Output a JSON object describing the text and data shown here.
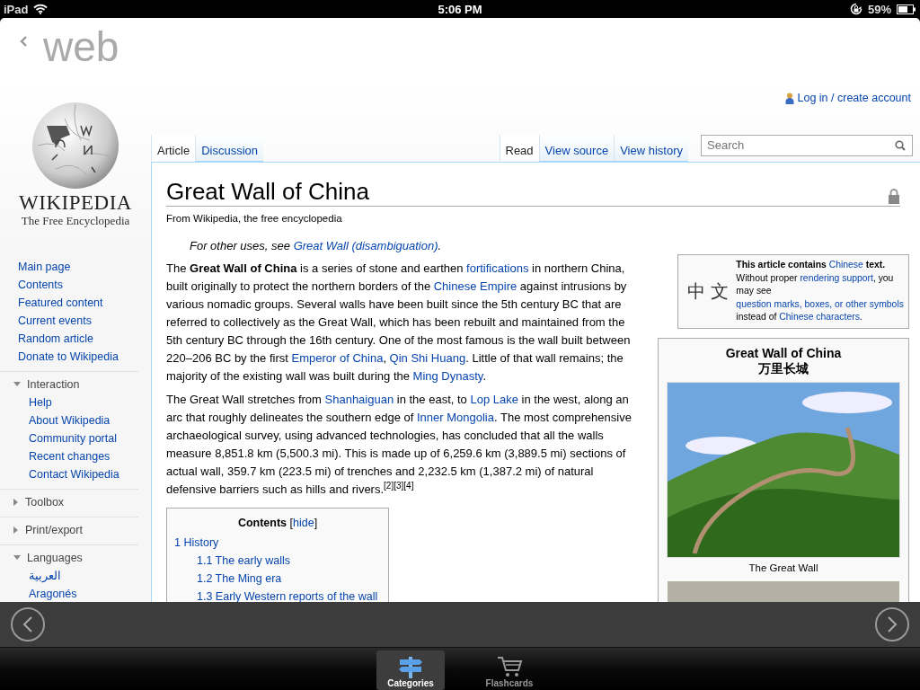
{
  "status_bar": {
    "carrier": "iPad",
    "time": "5:06 PM",
    "battery": "59%"
  },
  "app_header": {
    "title": "web"
  },
  "wiki": {
    "personal_link": "Log in / create account",
    "logo": {
      "wordmark": "WIKIPEDIA",
      "tagline": "The Free Encyclopedia"
    },
    "nav": [
      "Main page",
      "Contents",
      "Featured content",
      "Current events",
      "Random article",
      "Donate to Wikipedia"
    ],
    "portals": [
      {
        "title": "Interaction",
        "expanded": true,
        "items": [
          "Help",
          "About Wikipedia",
          "Community portal",
          "Recent changes",
          "Contact Wikipedia"
        ]
      },
      {
        "title": "Toolbox",
        "expanded": false
      },
      {
        "title": "Print/export",
        "expanded": false
      },
      {
        "title": "Languages",
        "expanded": true,
        "items": [
          "العربية",
          "Aragonés"
        ]
      }
    ],
    "left_tabs": [
      {
        "label": "Article",
        "selected": true
      },
      {
        "label": "Discussion",
        "selected": false
      }
    ],
    "right_tabs": [
      {
        "label": "Read",
        "selected": true
      },
      {
        "label": "View source",
        "selected": false
      },
      {
        "label": "View history",
        "selected": false
      }
    ],
    "search": {
      "placeholder": "Search"
    },
    "title": "Great Wall of China",
    "tagline": "From Wikipedia, the free encyclopedia",
    "hatnote": [
      {
        "kind": "plain",
        "text": "For other uses, see "
      },
      {
        "kind": "link",
        "text": "Great Wall (disambiguation)"
      },
      {
        "kind": "plain",
        "text": "."
      }
    ],
    "paragraphs": [
      [
        {
          "kind": "plain",
          "text": "The "
        },
        {
          "kind": "bold",
          "text": "Great Wall of China"
        },
        {
          "kind": "plain",
          "text": " is a series of stone and earthen "
        },
        {
          "kind": "link",
          "text": "fortifications"
        },
        {
          "kind": "plain",
          "text": " in northern China, built originally to protect the northern borders of the "
        },
        {
          "kind": "link",
          "text": "Chinese Empire"
        },
        {
          "kind": "plain",
          "text": " against intrusions by various nomadic groups. Several walls have been built since the 5th century BC that are referred to collectively as the Great Wall, which has been rebuilt and maintained from the 5th century BC through the 16th century. One of the most famous is the wall built between 220–206 BC by the first "
        },
        {
          "kind": "link",
          "text": "Emperor of China"
        },
        {
          "kind": "plain",
          "text": ", "
        },
        {
          "kind": "link",
          "text": "Qin Shi Huang"
        },
        {
          "kind": "plain",
          "text": ". Little of that wall remains; the majority of the existing wall was built during the "
        },
        {
          "kind": "link",
          "text": "Ming Dynasty"
        },
        {
          "kind": "plain",
          "text": "."
        }
      ],
      [
        {
          "kind": "plain",
          "text": "The Great Wall stretches from "
        },
        {
          "kind": "link",
          "text": "Shanhaiguan"
        },
        {
          "kind": "plain",
          "text": " in the east, to "
        },
        {
          "kind": "link",
          "text": "Lop Lake"
        },
        {
          "kind": "plain",
          "text": " in the west, along an arc that roughly delineates the southern edge of "
        },
        {
          "kind": "link",
          "text": "Inner Mongolia"
        },
        {
          "kind": "plain",
          "text": ". The most comprehensive archaeological survey, using advanced technologies, has concluded that all the walls measure 8,851.8 km (5,500.3 mi). This is made up of 6,259.6 km (3,889.5 mi) sections of actual wall, 359.7 km (223.5 mi) of trenches and 2,232.5 km (1,387.2 mi) of natural defensive barriers such as hills and rivers."
        },
        {
          "kind": "ref",
          "text": "[2]"
        },
        {
          "kind": "ref",
          "text": "[3]"
        },
        {
          "kind": "ref",
          "text": "[4]"
        }
      ]
    ],
    "toc": {
      "heading": [
        {
          "kind": "bold",
          "text": "Contents"
        },
        {
          "kind": "plain",
          "text": " ["
        },
        {
          "kind": "link",
          "text": "hide"
        },
        {
          "kind": "plain",
          "text": "]"
        }
      ],
      "entries": [
        {
          "number": "1",
          "label": "History",
          "children": [
            {
              "number": "1.1",
              "label": "The early walls"
            },
            {
              "number": "1.2",
              "label": "The Ming era"
            },
            {
              "number": "1.3",
              "label": "Early Western reports of the wall"
            }
          ]
        }
      ]
    },
    "notice": {
      "glyph": "中 文",
      "segments": [
        {
          "kind": "bold",
          "text": "This article contains "
        },
        {
          "kind": "link",
          "text": "Chinese"
        },
        {
          "kind": "bold",
          "text": " text."
        },
        {
          "kind": "plain",
          "text": " Without proper "
        },
        {
          "kind": "link",
          "text": "rendering "
        },
        {
          "kind": "link",
          "text": "support"
        },
        {
          "kind": "plain",
          "text": ", you may see "
        },
        {
          "kind": "link",
          "text": "question "
        },
        {
          "kind": "link",
          "text": "marks, boxes, or other symbols"
        },
        {
          "kind": "plain",
          "text": " instead of "
        },
        {
          "kind": "link",
          "text": "Chinese characters"
        },
        {
          "kind": "plain",
          "text": "."
        }
      ]
    },
    "infobox": {
      "title": "Great Wall of China",
      "subtitle": "万里长城",
      "caption": "The Great Wall"
    }
  },
  "tab_bar": [
    {
      "label": "Categories",
      "kind": "signpost",
      "selected": true
    },
    {
      "label": "Flashcards",
      "kind": "cart",
      "selected": false
    }
  ]
}
